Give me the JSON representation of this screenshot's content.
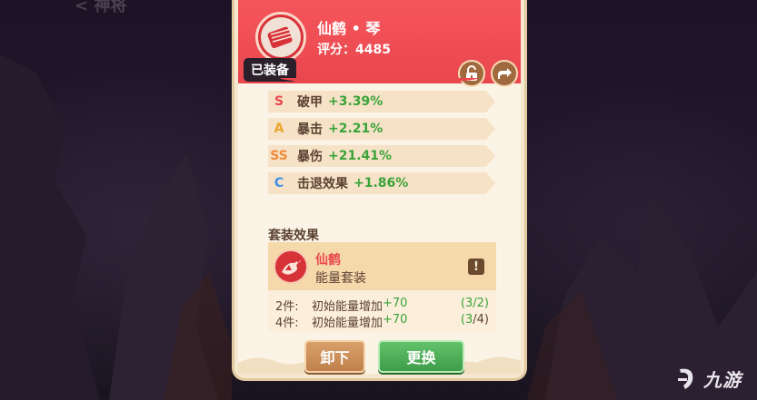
{
  "background": {
    "back_label": "< 神将"
  },
  "item": {
    "name": "仙鹤 • 琴",
    "score_label": "评分：",
    "score_value": "4485",
    "equipped_badge": "已装备",
    "icon": "guqin-instrument-icon",
    "header_color": "#e9474e"
  },
  "header_actions": {
    "lock_icon": "unlock-icon",
    "share_icon": "share-icon"
  },
  "stats": [
    {
      "grade": "S",
      "grade_color": "#e8484d",
      "name": "破甲",
      "value": "+3.39%"
    },
    {
      "grade": "A",
      "grade_color": "#e9a52b",
      "name": "暴击",
      "value": "+2.21%"
    },
    {
      "grade": "SS",
      "grade_color": "#f08a3a",
      "name": "暴伤",
      "value": "+21.41%"
    },
    {
      "grade": "C",
      "grade_color": "#3e8fe6",
      "name": "击退效果",
      "value": "+1.86%"
    }
  ],
  "set_effect": {
    "title": "套装效果",
    "set_name": "仙鹤",
    "set_type": "能量套装",
    "info_label": "!",
    "icon": "crane-icon",
    "bonuses": [
      {
        "pieces": "2件:",
        "text": "初始能量增加",
        "value": "+70",
        "progress_open": "(3",
        "progress_close": "/2)"
      },
      {
        "pieces": "4件:",
        "text": "初始能量增加",
        "value": "+70",
        "progress_open": "(3",
        "progress_close": "/4)"
      }
    ]
  },
  "buttons": {
    "unequip": "卸下",
    "replace": "更换"
  },
  "watermark": {
    "text": "九游"
  }
}
